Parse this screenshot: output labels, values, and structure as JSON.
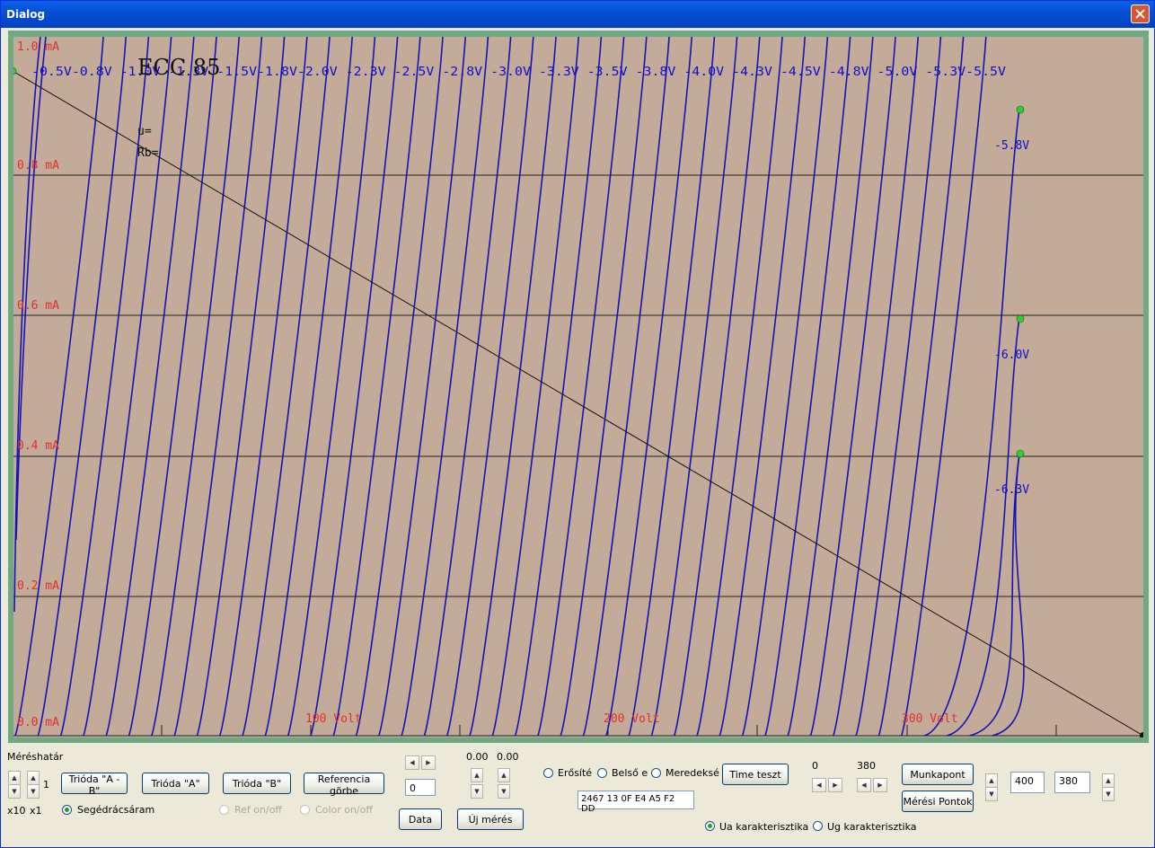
{
  "window": {
    "title": "Dialog"
  },
  "plot": {
    "tube": "ECC 85",
    "param_mu": "u=",
    "param_rb": "Rb=",
    "y_labels": [
      "1.0 mA",
      "0.8 mA",
      "0.6 mA",
      "0.4 mA",
      "0.2 mA",
      "0.0 mA"
    ],
    "x_labels": [
      "100 Volt",
      "200 Volt",
      "300 Volt"
    ],
    "top_labels_text": "-0.5V-0.8V -1.0V -1.3V -1.5V-1.8V-2.0V -2.3V -2.5V -2.8V -3.0V -3.3V -3.5V -3.8V -4.0V -4.3V -4.5V -4.8V -5.0V -5.3V-5.5V",
    "curve_labels": [
      "-5.8V",
      "-6.0V",
      "-6.3V"
    ],
    "colors": {
      "background": "#C4AA98",
      "frame": "#6FA883",
      "curve": "#1414B4",
      "axis_text": "#E03030",
      "label_text": "#1010C8",
      "point": "#33CC33"
    }
  },
  "controls": {
    "range_label": "Méréshatár",
    "range_value": "1",
    "x10": "x10",
    "x1": "x1",
    "btn_trioda_ab": "Trióda \"A - B\"",
    "btn_trioda_a": "Trióda \"A\"",
    "btn_trioda_b": "Trióda \"B\"",
    "btn_referencia": "Referencia görbe",
    "segedracs": "Segédrácsáram",
    "ref_onoff": "Ref on/off",
    "color_onoff": "Color on/off",
    "edit_zero": "0",
    "btn_data": "Data",
    "val1": "0.00",
    "val2": "0.00",
    "btn_uj_meres": "Új mérés",
    "radio_erosite": "Erősíté",
    "radio_belso": "Belső e",
    "radio_meredekse": "Meredeksé",
    "btn_time": "Time teszt",
    "hex_value": "2467  13 0F E4 A5 F2 DD",
    "scroll_left_val": "0",
    "scroll_right_val": "380",
    "btn_munkapont": "Munkapont",
    "btn_meresi": "Mérési Pontok",
    "edit_400": "400",
    "edit_380": "380",
    "radio_ua": "Ua karakterisztika",
    "radio_ug": "Ug karakterisztika"
  }
}
